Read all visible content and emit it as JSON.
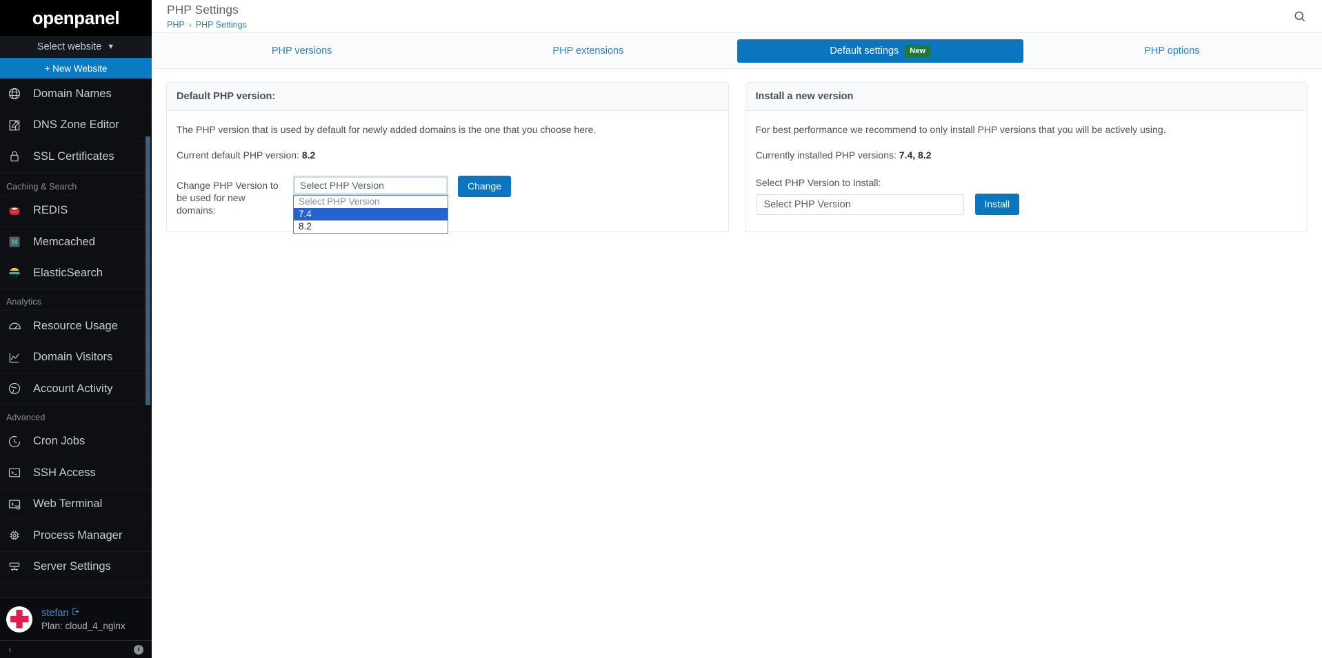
{
  "sidebar": {
    "brand": "openpanel",
    "site_select_label": "Select website",
    "new_website_label": "+ New Website",
    "items": [
      {
        "label": "Domain Names",
        "icon": "globe-icon",
        "type": "item"
      },
      {
        "label": "DNS Zone Editor",
        "icon": "edit-square-icon",
        "type": "item"
      },
      {
        "label": "SSL Certificates",
        "icon": "lock-icon",
        "type": "item"
      },
      {
        "label": "Caching & Search",
        "icon": "",
        "type": "group"
      },
      {
        "label": "REDIS",
        "icon": "redis-icon",
        "type": "item"
      },
      {
        "label": "Memcached",
        "icon": "memcached-icon",
        "type": "item"
      },
      {
        "label": "ElasticSearch",
        "icon": "elasticsearch-icon",
        "type": "item"
      },
      {
        "label": "Analytics",
        "icon": "",
        "type": "group"
      },
      {
        "label": "Resource Usage",
        "icon": "gauge-icon",
        "type": "item"
      },
      {
        "label": "Domain Visitors",
        "icon": "line-chart-icon",
        "type": "item"
      },
      {
        "label": "Account Activity",
        "icon": "globe-activity-icon",
        "type": "item"
      },
      {
        "label": "Advanced",
        "icon": "",
        "type": "group"
      },
      {
        "label": "Cron Jobs",
        "icon": "clock-icon",
        "type": "item"
      },
      {
        "label": "SSH Access",
        "icon": "terminal-icon",
        "type": "item"
      },
      {
        "label": "Web Terminal",
        "icon": "web-terminal-icon",
        "type": "item"
      },
      {
        "label": "Process Manager",
        "icon": "cpu-icon",
        "type": "item"
      },
      {
        "label": "Server Settings",
        "icon": "server-icon",
        "type": "item"
      }
    ],
    "user": {
      "name": "stefan",
      "plan": "Plan: cloud_4_nginx"
    },
    "footer": {
      "collapse": "‹",
      "info": "i"
    },
    "accent": "#0b7ac4",
    "scrollbar_color": "#3d5f78"
  },
  "header": {
    "title": "PHP Settings",
    "breadcrumb": {
      "root": "PHP",
      "separator": "›",
      "current": "PHP Settings"
    },
    "search_icon": "search-icon"
  },
  "tabs": [
    {
      "label": "PHP versions",
      "active": false,
      "badge": ""
    },
    {
      "label": "PHP extensions",
      "active": false,
      "badge": ""
    },
    {
      "label": "Default settings",
      "active": true,
      "badge": "New"
    },
    {
      "label": "PHP options",
      "active": false,
      "badge": ""
    }
  ],
  "left_card": {
    "title": "Default PHP version:",
    "description": "The PHP version that is used by default for newly added domains is the one that you choose here.",
    "current_label": "Current default PHP version:",
    "current_value": "8.2",
    "change_row_label": "Change PHP Version to be used for new domains:",
    "select_value": "Select PHP Version",
    "select_placeholder": "Select PHP Version",
    "options": [
      {
        "label": "Select PHP Version",
        "state": "placeholder"
      },
      {
        "label": "7.4",
        "state": "selected"
      },
      {
        "label": "8.2",
        "state": "normal"
      }
    ],
    "change_button": "Change"
  },
  "right_card": {
    "title": "Install a new version",
    "description": "For best performance we recommend to only install PHP versions that you will be actively using.",
    "installed_label": "Currently installed PHP versions:",
    "installed_value": "7.4, 8.2",
    "install_select_label": "Select PHP Version to Install:",
    "install_select_value": "Select PHP Version",
    "install_button": "Install"
  },
  "colors": {
    "primary": "#0b76bd",
    "sidebar_bg": "#0d0f12",
    "badge_green": "#1f7a38",
    "option_highlight": "#2463d1"
  }
}
